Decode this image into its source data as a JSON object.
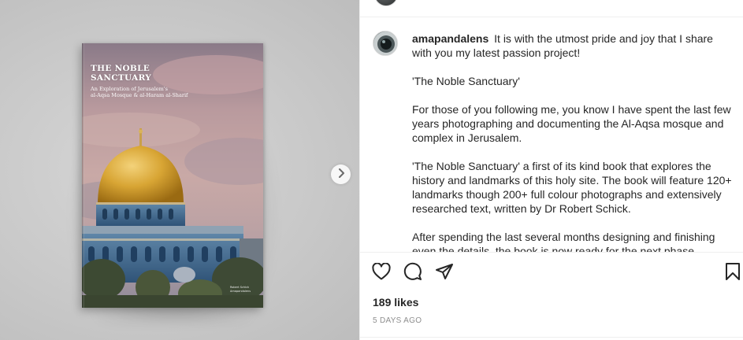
{
  "media": {
    "book": {
      "title": "THE NOBLE\nSANCTUARY",
      "subtitle": "An Exploration of Jerusalem's\nal-Aqsa Mosque & al-Haram al-Sharif",
      "credit": "Robert Schick\nAmapandalens"
    },
    "next_icon": "chevron-right-icon"
  },
  "post": {
    "username": "amapandalens",
    "paragraphs": [
      "It is with the utmost pride and joy that I share with you my latest passion project!",
      "'The Noble Sanctuary'",
      "For those of you following me, you know I have spent the last few years photographing and documenting the Al-Aqsa mosque and complex in Jerusalem.",
      "'The Noble Sanctuary' a first of its kind book that explores the history and landmarks of this holy site. The book will feature 120+ landmarks though 200+ full colour photographs and extensively researched text, written by Dr Robert Schick.",
      "After spending the last several months designing and finishing even the details, the book is now ready for the next phase."
    ]
  },
  "actions": {
    "icons": [
      "heart-icon",
      "comment-icon",
      "share-icon",
      "bookmark-icon"
    ]
  },
  "likes": "189 likes",
  "timestamp": "5 DAYS AGO"
}
